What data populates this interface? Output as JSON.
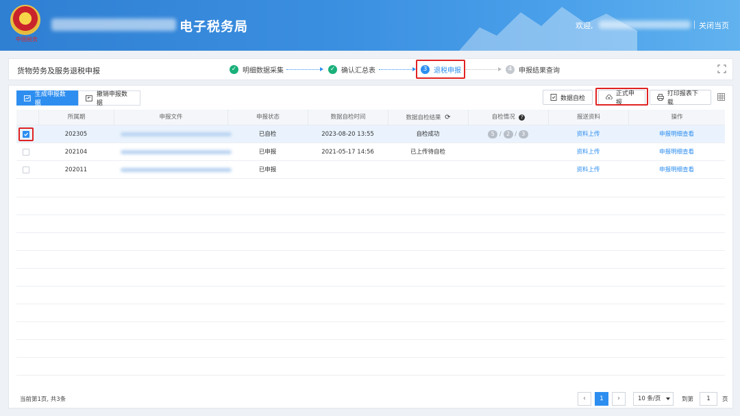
{
  "header": {
    "emblem_caption": "中国税务",
    "title": "电子税务局",
    "welcome": "欢迎,",
    "close_page": "关闭当页"
  },
  "stepbar": {
    "page_title": "货物劳务及服务退税申报",
    "steps": [
      {
        "num": "✓",
        "label": "明细数据采集",
        "state": "done"
      },
      {
        "num": "✓",
        "label": "确认汇总表",
        "state": "done"
      },
      {
        "num": "3",
        "label": "退税申报",
        "state": "current"
      },
      {
        "num": "4",
        "label": "申报结果查询",
        "state": "todo"
      }
    ]
  },
  "tabs": [
    {
      "label": "生成申报数据",
      "active": true
    },
    {
      "label": "撤销申报数据",
      "active": false
    }
  ],
  "toolbar": {
    "data_check": "数据自检",
    "formal_declare": "正式申报",
    "print_download": "打印报表下载"
  },
  "table": {
    "columns": [
      "所属期",
      "申报文件",
      "申报状态",
      "数据自检时间",
      "数据自检结果",
      "自检情况",
      "报送资料",
      "操作"
    ],
    "rows": [
      {
        "period": "202305",
        "status": "已自检",
        "check_time": "2023-08-20 13:55",
        "check_result": "自检成功",
        "pills": [
          "5",
          "2",
          "3"
        ],
        "upload": "资料上传",
        "action": "申报明细查看",
        "checked": true
      },
      {
        "period": "202104",
        "status": "已申报",
        "check_time": "2021-05-17 14:56",
        "check_result": "已上传待自检",
        "pills": [],
        "upload": "资料上传",
        "action": "申报明细查看",
        "checked": false
      },
      {
        "period": "202011",
        "status": "已申报",
        "check_time": "",
        "check_result": "",
        "pills": [],
        "upload": "资料上传",
        "action": "申报明细查看",
        "checked": false
      }
    ]
  },
  "pagination": {
    "summary": "当前第1页, 共3条",
    "current_page": "1",
    "page_size": "10 条/页",
    "goto_label": "到第",
    "goto_value": "1",
    "page_suffix": "页"
  },
  "colors": {
    "primary": "#2d8ef0",
    "success": "#19b07a",
    "highlight": "#e02020",
    "header_start": "#2f7fd3",
    "header_end": "#61b2ee"
  }
}
